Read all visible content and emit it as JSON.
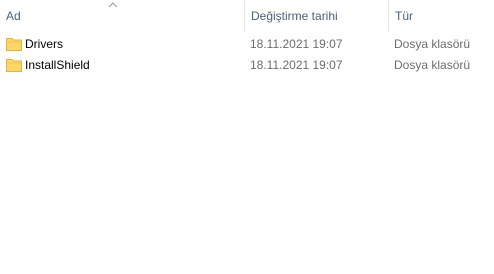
{
  "columns": {
    "name": "Ad",
    "date": "Değiştirme tarihi",
    "type": "Tür"
  },
  "sort": {
    "column": "name",
    "direction": "ascending",
    "icon": "sort-up-chevron-icon"
  },
  "files": [
    {
      "icon": "folder-icon",
      "name": "Drivers",
      "modified": "18.11.2021 19:07",
      "type": "Dosya klasörü"
    },
    {
      "icon": "folder-icon",
      "name": "InstallShield",
      "modified": "18.11.2021 19:07",
      "type": "Dosya klasörü"
    }
  ],
  "colors": {
    "header_text": "#4c607a",
    "folder_fill": "#ffd766",
    "folder_tab": "#e8b84a"
  }
}
